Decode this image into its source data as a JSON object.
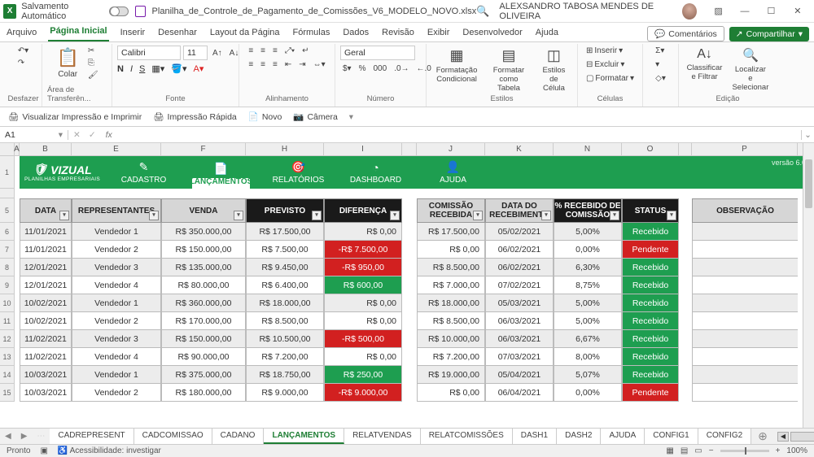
{
  "titlebar": {
    "autosave": "Salvamento Automático",
    "filename": "Planilha_de_Controle_de_Pagamento_de_Comissões_V6_MODELO_NOVO.xlsx",
    "username": "ALEXSANDRO TABOSA MENDES DE OLIVEIRA"
  },
  "menu": {
    "tabs": [
      "Arquivo",
      "Página Inicial",
      "Inserir",
      "Desenhar",
      "Layout da Página",
      "Fórmulas",
      "Dados",
      "Revisão",
      "Exibir",
      "Desenvolvedor",
      "Ajuda"
    ],
    "comments": "Comentários",
    "share": "Compartilhar"
  },
  "ribbon": {
    "undo": "Desfazer",
    "paste": "Colar",
    "clipboard": "Área de Transferên...",
    "font": "Fonte",
    "fontname": "Calibri",
    "fontsize": "11",
    "align": "Alinhamento",
    "numfmt": "Geral",
    "number": "Número",
    "condfmt": "Formatação Condicional",
    "tblfmt": "Formatar como Tabela",
    "cellstyle": "Estilos de Célula",
    "styles": "Estilos",
    "insert": "Inserir",
    "delete": "Excluir",
    "format": "Formatar",
    "cells": "Células",
    "sortfilter": "Classificar e Filtrar",
    "findselect": "Localizar e Selecionar",
    "editing": "Edição"
  },
  "qat": {
    "printview": "Visualizar Impressão e Imprimir",
    "quickprint": "Impressão Rápida",
    "new": "Novo",
    "camera": "Câmera"
  },
  "namebox": "A1",
  "cols": [
    "B",
    "E",
    "F",
    "H",
    "I",
    "J",
    "K",
    "N",
    "O",
    "P"
  ],
  "band": {
    "brand": "VIZUAL",
    "brandsub": "PLANILHAS EMPRESARIAIS",
    "nav": [
      "CADASTRO",
      "LANÇAMENTOS",
      "RELATÓRIOS",
      "DASHBOARD",
      "AJUDA"
    ],
    "version": "versão 6.0"
  },
  "thdr": [
    "DATA",
    "REPRESENTANTES",
    "VENDA",
    "PREVISTO",
    "DIFERENÇA",
    "COMISSÃO RECEBIDA",
    "DATA DO RECEBIMENTO",
    "% RECEBIDO DE COMISSÃO",
    "STATUS",
    "OBSERVAÇÃO"
  ],
  "rows": [
    {
      "data": "11/01/2021",
      "rep": "Vendedor 1",
      "venda": "R$ 350.000,00",
      "prev": "R$ 17.500,00",
      "diff": "R$ 0,00",
      "dcls": "",
      "com": "R$ 17.500,00",
      "drec": "05/02/2021",
      "pct": "5,00%",
      "stat": "Recebido",
      "scls": "g"
    },
    {
      "data": "11/01/2021",
      "rep": "Vendedor 2",
      "venda": "R$ 150.000,00",
      "prev": "R$ 7.500,00",
      "diff": "-R$ 7.500,00",
      "dcls": "r",
      "com": "R$ 0,00",
      "drec": "06/02/2021",
      "pct": "0,00%",
      "stat": "Pendente",
      "scls": "r"
    },
    {
      "data": "12/01/2021",
      "rep": "Vendedor 3",
      "venda": "R$ 135.000,00",
      "prev": "R$ 9.450,00",
      "diff": "-R$ 950,00",
      "dcls": "r",
      "com": "R$ 8.500,00",
      "drec": "06/02/2021",
      "pct": "6,30%",
      "stat": "Recebido",
      "scls": "g"
    },
    {
      "data": "12/01/2021",
      "rep": "Vendedor 4",
      "venda": "R$ 80.000,00",
      "prev": "R$ 6.400,00",
      "diff": "R$ 600,00",
      "dcls": "g",
      "com": "R$ 7.000,00",
      "drec": "07/02/2021",
      "pct": "8,75%",
      "stat": "Recebido",
      "scls": "g"
    },
    {
      "data": "10/02/2021",
      "rep": "Vendedor 1",
      "venda": "R$ 360.000,00",
      "prev": "R$ 18.000,00",
      "diff": "R$ 0,00",
      "dcls": "",
      "com": "R$ 18.000,00",
      "drec": "05/03/2021",
      "pct": "5,00%",
      "stat": "Recebido",
      "scls": "g"
    },
    {
      "data": "10/02/2021",
      "rep": "Vendedor 2",
      "venda": "R$ 170.000,00",
      "prev": "R$ 8.500,00",
      "diff": "R$ 0,00",
      "dcls": "",
      "com": "R$ 8.500,00",
      "drec": "06/03/2021",
      "pct": "5,00%",
      "stat": "Recebido",
      "scls": "g"
    },
    {
      "data": "11/02/2021",
      "rep": "Vendedor 3",
      "venda": "R$ 150.000,00",
      "prev": "R$ 10.500,00",
      "diff": "-R$ 500,00",
      "dcls": "r",
      "com": "R$ 10.000,00",
      "drec": "06/03/2021",
      "pct": "6,67%",
      "stat": "Recebido",
      "scls": "g"
    },
    {
      "data": "11/02/2021",
      "rep": "Vendedor 4",
      "venda": "R$ 90.000,00",
      "prev": "R$ 7.200,00",
      "diff": "R$ 0,00",
      "dcls": "",
      "com": "R$ 7.200,00",
      "drec": "07/03/2021",
      "pct": "8,00%",
      "stat": "Recebido",
      "scls": "g"
    },
    {
      "data": "10/03/2021",
      "rep": "Vendedor 1",
      "venda": "R$ 375.000,00",
      "prev": "R$ 18.750,00",
      "diff": "R$ 250,00",
      "dcls": "g",
      "com": "R$ 19.000,00",
      "drec": "05/04/2021",
      "pct": "5,07%",
      "stat": "Recebido",
      "scls": "g"
    },
    {
      "data": "10/03/2021",
      "rep": "Vendedor 2",
      "venda": "R$ 180.000,00",
      "prev": "R$ 9.000,00",
      "diff": "-R$ 9.000,00",
      "dcls": "r",
      "com": "R$ 0,00",
      "drec": "06/04/2021",
      "pct": "0,00%",
      "stat": "Pendente",
      "scls": "r"
    }
  ],
  "rownums": [
    "1",
    "",
    "5",
    "6",
    "7",
    "8",
    "9",
    "10",
    "11",
    "12",
    "13",
    "14",
    "15"
  ],
  "sheets": [
    "CADREPRESENT",
    "CADCOMISSAO",
    "CADANO",
    "LANÇAMENTOS",
    "RELATVENDAS",
    "RELATCOMISSÕES",
    "DASH1",
    "DASH2",
    "AJUDA",
    "CONFIG1",
    "CONFIG2"
  ],
  "status": {
    "ready": "Pronto",
    "access": "Acessibilidade: investigar",
    "zoom": "100%"
  }
}
